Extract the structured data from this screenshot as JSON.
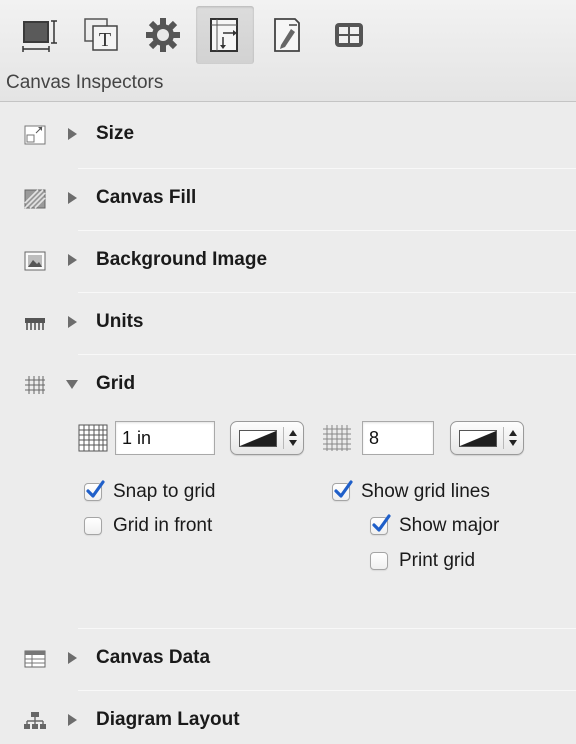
{
  "toolbar": {
    "title": "Canvas Inspectors",
    "buttons": [
      {
        "icon": "canvas-size-icon",
        "active": false
      },
      {
        "icon": "text-icon",
        "active": false
      },
      {
        "icon": "gear-icon",
        "active": false
      },
      {
        "icon": "canvas-inspector-icon",
        "active": true
      },
      {
        "icon": "document-edit-icon",
        "active": false
      },
      {
        "icon": "grid-tiles-icon",
        "active": false
      }
    ]
  },
  "sections": {
    "size": {
      "label": "Size",
      "icon": "size-icon",
      "expanded": false
    },
    "canvas_fill": {
      "label": "Canvas Fill",
      "icon": "fill-icon",
      "expanded": false
    },
    "background_image": {
      "label": "Background Image",
      "icon": "image-icon",
      "expanded": false
    },
    "units": {
      "label": "Units",
      "icon": "ruler-icon",
      "expanded": false
    },
    "grid": {
      "label": "Grid",
      "icon": "grid-icon",
      "expanded": true
    },
    "canvas_data": {
      "label": "Canvas Data",
      "icon": "table-icon",
      "expanded": false
    },
    "diagram_layout": {
      "label": "Diagram Layout",
      "icon": "hierarchy-icon",
      "expanded": false
    }
  },
  "grid": {
    "spacing_value": "1 in",
    "major_value": "8",
    "options": {
      "snap_to_grid": {
        "label": "Snap to grid",
        "checked": true
      },
      "grid_in_front": {
        "label": "Grid in front",
        "checked": false
      },
      "show_grid_lines": {
        "label": "Show grid lines",
        "checked": true
      },
      "show_major": {
        "label": "Show major",
        "checked": true
      },
      "print_grid": {
        "label": "Print grid",
        "checked": false
      }
    }
  },
  "colors": {
    "accent": "#2a6ed8",
    "check": "#1f5fc9",
    "background": "#ececec"
  }
}
